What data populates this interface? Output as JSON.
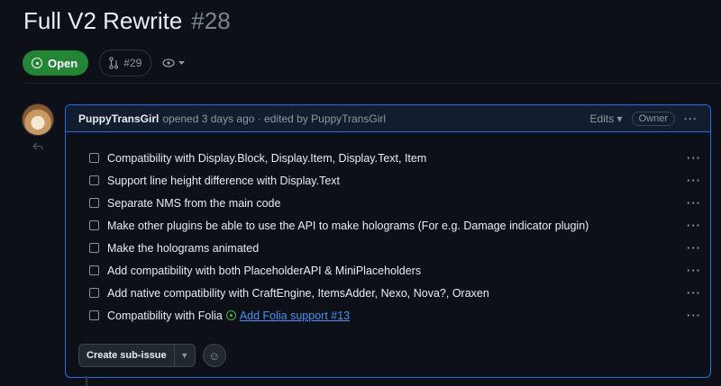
{
  "issue": {
    "title": "Full V2 Rewrite",
    "number": "#28",
    "state": "Open",
    "linked_pr": "#29"
  },
  "comment": {
    "author": "PuppyTransGirl",
    "opened_text": "opened 3 days ago · edited by PuppyTransGirl",
    "edits_label": "Edits ▾",
    "owner_badge": "Owner",
    "more": "···"
  },
  "tasks": [
    {
      "label": "Compatibility with Display.Block, Display.Item, Display.Text, Item",
      "checked": false
    },
    {
      "label": "Support line height difference with Display.Text",
      "checked": false
    },
    {
      "label": "Separate NMS from the main code",
      "checked": false
    },
    {
      "label": "Make other plugins be able to use the API to make holograms (For e.g. Damage indicator plugin)",
      "checked": false
    },
    {
      "label": "Make the holograms animated",
      "checked": false
    },
    {
      "label": "Add compatibility with both PlaceholderAPI & MiniPlaceholders",
      "checked": false
    },
    {
      "label": "Add native compatibility with CraftEngine, ItemsAdder, Nexo, Nova?, Oraxen",
      "checked": false
    },
    {
      "label": "Compatibility with Folia",
      "checked": false,
      "ref": "Add Folia support #13"
    }
  ],
  "task_menu": "···",
  "footer": {
    "create_sub_issue": "Create sub-issue"
  },
  "colors": {
    "accent_blue": "#1f6feb",
    "open_green": "#238636",
    "link": "#4493f8"
  }
}
